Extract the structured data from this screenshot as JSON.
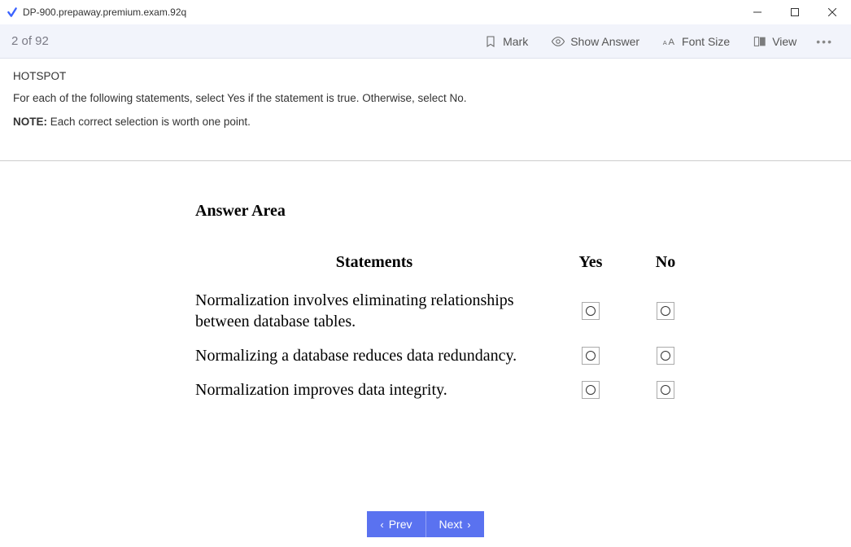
{
  "window": {
    "title": "DP-900.prepaway.premium.exam.92q"
  },
  "toolbar": {
    "counter": "2 of 92",
    "mark": "Mark",
    "show_answer": "Show Answer",
    "font_size": "Font Size",
    "view": "View"
  },
  "question": {
    "type_label": "HOTSPOT",
    "instruction": "For each of the following statements, select Yes if the statement is true. Otherwise, select No.",
    "note_prefix": "NOTE:",
    "note_text": " Each correct selection is worth one point."
  },
  "answer_area": {
    "title": "Answer Area",
    "col_statements": "Statements",
    "col_yes": "Yes",
    "col_no": "No",
    "rows": [
      "Normalization involves eliminating relationships between database tables.",
      "Normalizing a database reduces data redundancy.",
      "Normalization improves data integrity."
    ]
  },
  "nav": {
    "prev": "Prev",
    "next": "Next"
  }
}
